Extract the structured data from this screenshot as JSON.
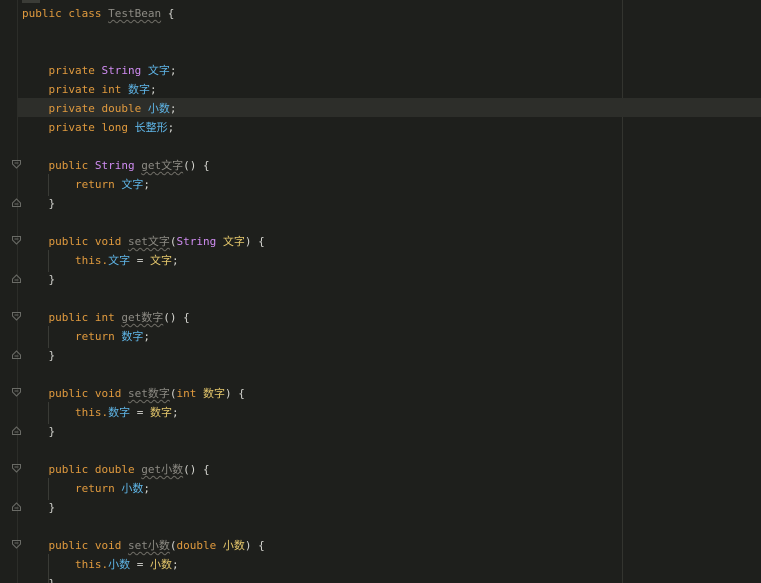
{
  "code": {
    "class_kw": "public class",
    "class_name": "TestBean",
    "open_brace": "{",
    "close_brace": "}",
    "fields": [
      {
        "modifier": "private",
        "type": "String",
        "name": "文字",
        "end": ";"
      },
      {
        "modifier": "private",
        "type": "int",
        "name": "数字",
        "end": ";"
      },
      {
        "modifier": "private",
        "type": "double",
        "name": "小数",
        "end": ";"
      },
      {
        "modifier": "private",
        "type": "long",
        "name": "长整形",
        "end": ";"
      }
    ],
    "getter_string": {
      "decl_kw": "public",
      "ret_type": "String",
      "name": "get文字",
      "sig": "() {",
      "return_kw": "return",
      "ret_val": "文字",
      "end": ";"
    },
    "setter_string": {
      "decl_kw": "public void",
      "name": "set文字",
      "open": "(",
      "ptype": "String",
      "pname": "文字",
      "close": ") {",
      "this_kw": "this.",
      "field": "文字",
      "eq": " = ",
      "val": "文字",
      "end": ";"
    },
    "getter_int": {
      "decl_kw": "public int",
      "name": "get数字",
      "sig": "() {",
      "return_kw": "return",
      "ret_val": "数字",
      "end": ";"
    },
    "setter_int": {
      "decl_kw": "public void",
      "name": "set数字",
      "open": "(",
      "ptype": "int",
      "pname": "数字",
      "close": ") {",
      "this_kw": "this.",
      "field": "数字",
      "eq": " = ",
      "val": "数字",
      "end": ";"
    },
    "getter_double": {
      "decl_kw": "public double",
      "name": "get小数",
      "sig": "() {",
      "return_kw": "return",
      "ret_val": "小数",
      "end": ";"
    },
    "setter_double": {
      "decl_kw": "public void",
      "name": "set小数",
      "open": "(",
      "ptype": "double",
      "pname": "小数",
      "close": ") {",
      "this_kw": "this.",
      "field": "小数",
      "eq": " = ",
      "val": "小数",
      "end": ";"
    }
  }
}
